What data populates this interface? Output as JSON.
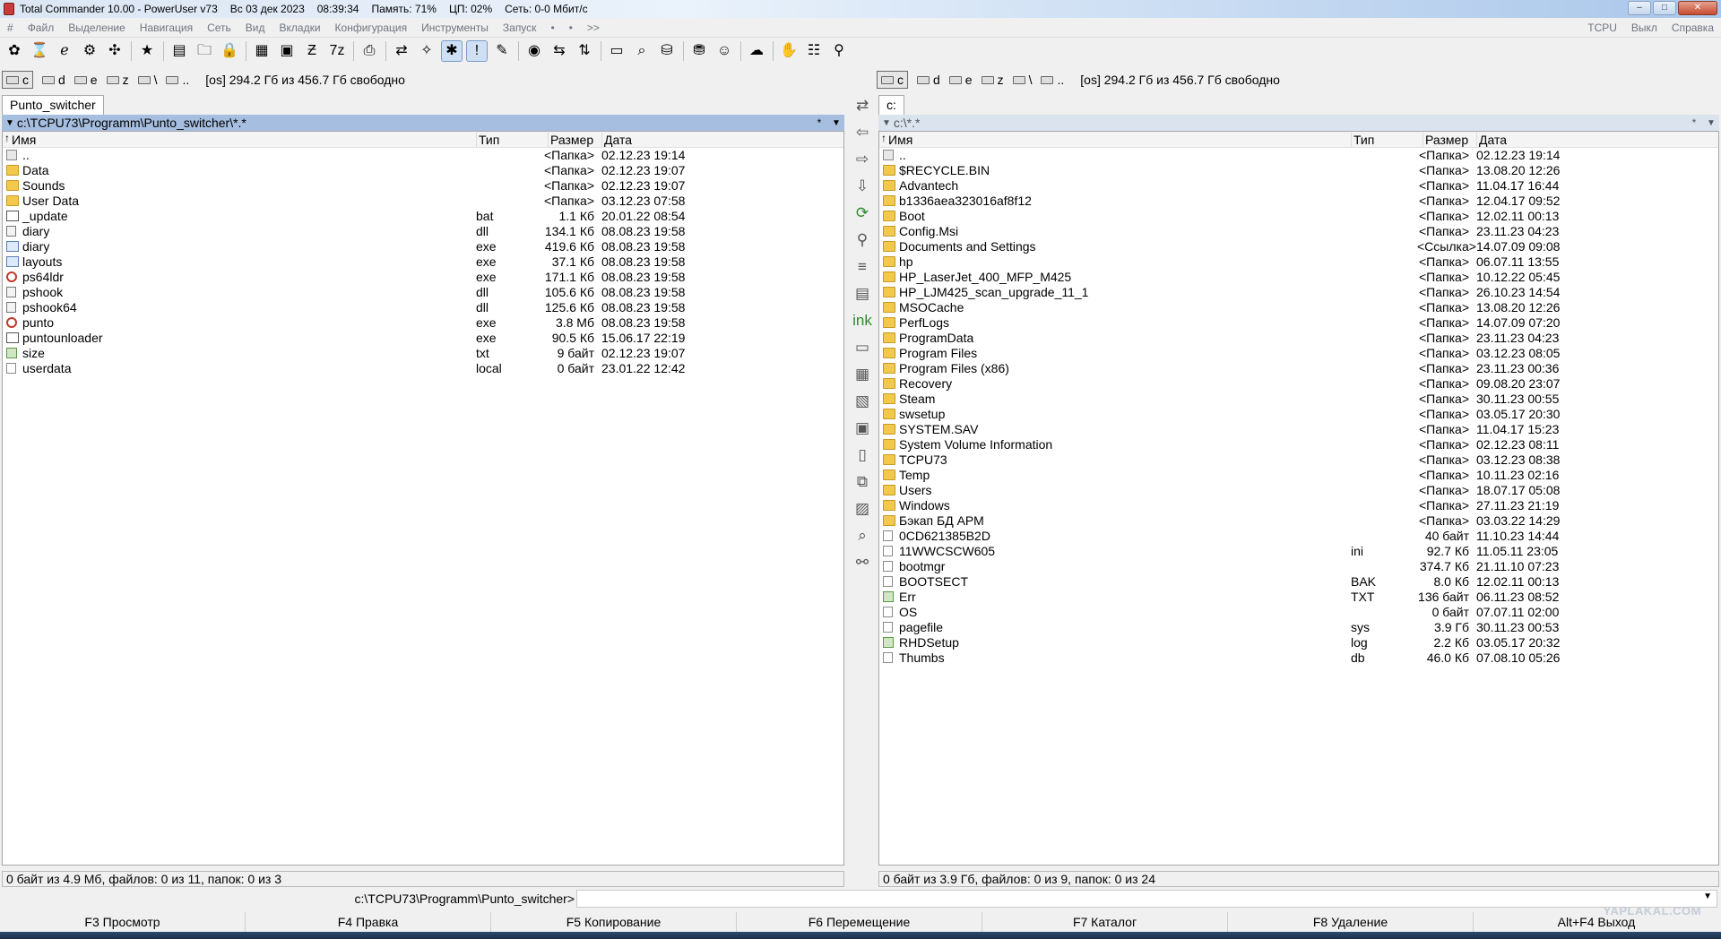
{
  "title_bar": {
    "app_title": "Total Commander 10.00 - PowerUser v73",
    "date": "Вс 03 дек 2023",
    "time": "08:39:34",
    "memory": "Память: 71%",
    "cpu": "ЦП: 02%",
    "network": "Сеть: 0-0 Мбит/с"
  },
  "menu": {
    "items": [
      "#",
      "Файл",
      "Выделение",
      "Навигация",
      "Сеть",
      "Вид",
      "Вкладки",
      "Конфигурация",
      "Инструменты",
      "Запуск",
      "•",
      "•",
      ">>"
    ],
    "right_items": [
      "TCPU",
      "Выкл",
      "Справка"
    ]
  },
  "toolbar": {
    "icons": [
      "paw-icon",
      "hourglass-icon",
      "ie-icon",
      "gear-icon",
      "puzzle-icon",
      "star-icon",
      "copy-names-icon",
      "folder-star-icon",
      "lock-icon",
      "winrar-icon",
      "archive-icon",
      "sfx-icon",
      "7z-icon",
      "printer-icon",
      "sync-icon",
      "wand-icon",
      "asterisk-icon",
      "alert-icon",
      "edit-icon",
      "ccleaner-icon",
      "compare-icon",
      "sort-icon",
      "folder-icon",
      "folder-search-icon",
      "drive-icon",
      "network-drive-icon",
      "rabbit-icon",
      "cloud-icon",
      "hand-icon",
      "tree-icon",
      "ftp-icon"
    ]
  },
  "left": {
    "drives": [
      "c",
      "d",
      "e",
      "z",
      "\\",
      ".."
    ],
    "active_drive": "c",
    "free_space": "[os]  294.2 Гб из 456.7 Гб свободно",
    "tab": "Punto_switcher",
    "path": "c:\\TCPU73\\Programm\\Punto_switcher\\*.*",
    "columns": [
      "Имя",
      "Тип",
      "Размер",
      "Дата"
    ],
    "files": [
      {
        "icon": "up",
        "name": "..",
        "type": "",
        "size": "<Папка>",
        "date": "02.12.23 19:14"
      },
      {
        "icon": "folder",
        "name": "Data",
        "type": "",
        "size": "<Папка>",
        "date": "02.12.23 19:07"
      },
      {
        "icon": "folder",
        "name": "Sounds",
        "type": "",
        "size": "<Папка>",
        "date": "02.12.23 19:07"
      },
      {
        "icon": "folder",
        "name": "User Data",
        "type": "",
        "size": "<Папка>",
        "date": "03.12.23 07:58"
      },
      {
        "icon": "bat",
        "name": "_update",
        "type": "bat",
        "size": "1.1 Кб",
        "date": "20.01.22 08:54"
      },
      {
        "icon": "dll",
        "name": "diary",
        "type": "dll",
        "size": "134.1 Кб",
        "date": "08.08.23 19:58"
      },
      {
        "icon": "exe",
        "name": "diary",
        "type": "exe",
        "size": "419.6 Кб",
        "date": "08.08.23 19:58"
      },
      {
        "icon": "exe",
        "name": "layouts",
        "type": "exe",
        "size": "37.1 Кб",
        "date": "08.08.23 19:58"
      },
      {
        "icon": "red",
        "name": "ps64ldr",
        "type": "exe",
        "size": "171.1 Кб",
        "date": "08.08.23 19:58"
      },
      {
        "icon": "dll",
        "name": "pshook",
        "type": "dll",
        "size": "105.6 Кб",
        "date": "08.08.23 19:58"
      },
      {
        "icon": "dll",
        "name": "pshook64",
        "type": "dll",
        "size": "125.6 Кб",
        "date": "08.08.23 19:58"
      },
      {
        "icon": "red",
        "name": "punto",
        "type": "exe",
        "size": "3.8 Мб",
        "date": "08.08.23 19:58"
      },
      {
        "icon": "bat",
        "name": "puntounloader",
        "type": "exe",
        "size": "90.5 Кб",
        "date": "15.06.17 22:19"
      },
      {
        "icon": "txt",
        "name": "size",
        "type": "txt",
        "size": "9 байт",
        "date": "02.12.23 19:07"
      },
      {
        "icon": "file",
        "name": "userdata",
        "type": "local",
        "size": "0 байт",
        "date": "23.01.22 12:42"
      }
    ],
    "status": "0 байт из 4.9 Мб, файлов: 0 из 11, папок: 0 из 3"
  },
  "right": {
    "drives": [
      "c",
      "d",
      "e",
      "z",
      "\\",
      ".."
    ],
    "active_drive": "c",
    "free_space": "[os]  294.2 Гб из 456.7 Гб свободно",
    "tab": "c:",
    "path": "c:\\*.*",
    "columns": [
      "Имя",
      "Тип",
      "Размер",
      "Дата"
    ],
    "files": [
      {
        "icon": "up",
        "name": "..",
        "type": "",
        "size": "<Папка>",
        "date": "02.12.23 19:14"
      },
      {
        "icon": "folder",
        "name": "$RECYCLE.BIN",
        "type": "",
        "size": "<Папка>",
        "date": "13.08.20 12:26"
      },
      {
        "icon": "folder",
        "name": "Advantech",
        "type": "",
        "size": "<Папка>",
        "date": "11.04.17 16:44"
      },
      {
        "icon": "folder",
        "name": "b1336aea323016af8f12",
        "type": "",
        "size": "<Папка>",
        "date": "12.04.17 09:52"
      },
      {
        "icon": "folder",
        "name": "Boot",
        "type": "",
        "size": "<Папка>",
        "date": "12.02.11 00:13"
      },
      {
        "icon": "folder",
        "name": "Config.Msi",
        "type": "",
        "size": "<Папка>",
        "date": "23.11.23 04:23"
      },
      {
        "icon": "folder",
        "name": "Documents and Settings",
        "type": "",
        "size": "<Ссылка>",
        "date": "14.07.09 09:08"
      },
      {
        "icon": "folder",
        "name": "hp",
        "type": "",
        "size": "<Папка>",
        "date": "06.07.11 13:55"
      },
      {
        "icon": "folder",
        "name": "HP_LaserJet_400_MFP_M425",
        "type": "",
        "size": "<Папка>",
        "date": "10.12.22 05:45"
      },
      {
        "icon": "folder",
        "name": "HP_LJM425_scan_upgrade_11_1",
        "type": "",
        "size": "<Папка>",
        "date": "26.10.23 14:54"
      },
      {
        "icon": "folder",
        "name": "MSOCache",
        "type": "",
        "size": "<Папка>",
        "date": "13.08.20 12:26"
      },
      {
        "icon": "folder",
        "name": "PerfLogs",
        "type": "",
        "size": "<Папка>",
        "date": "14.07.09 07:20"
      },
      {
        "icon": "folder",
        "name": "ProgramData",
        "type": "",
        "size": "<Папка>",
        "date": "23.11.23 04:23"
      },
      {
        "icon": "folder",
        "name": "Program Files",
        "type": "",
        "size": "<Папка>",
        "date": "03.12.23 08:05"
      },
      {
        "icon": "folder",
        "name": "Program Files (x86)",
        "type": "",
        "size": "<Папка>",
        "date": "23.11.23 00:36"
      },
      {
        "icon": "folder",
        "name": "Recovery",
        "type": "",
        "size": "<Папка>",
        "date": "09.08.20 23:07"
      },
      {
        "icon": "folder",
        "name": "Steam",
        "type": "",
        "size": "<Папка>",
        "date": "30.11.23 00:55"
      },
      {
        "icon": "folder",
        "name": "swsetup",
        "type": "",
        "size": "<Папка>",
        "date": "03.05.17 20:30"
      },
      {
        "icon": "folder",
        "name": "SYSTEM.SAV",
        "type": "",
        "size": "<Папка>",
        "date": "11.04.17 15:23"
      },
      {
        "icon": "folder",
        "name": "System Volume Information",
        "type": "",
        "size": "<Папка>",
        "date": "02.12.23 08:11"
      },
      {
        "icon": "folder",
        "name": "TCPU73",
        "type": "",
        "size": "<Папка>",
        "date": "03.12.23 08:38"
      },
      {
        "icon": "folder",
        "name": "Temp",
        "type": "",
        "size": "<Папка>",
        "date": "10.11.23 02:16"
      },
      {
        "icon": "folder",
        "name": "Users",
        "type": "",
        "size": "<Папка>",
        "date": "18.07.17 05:08"
      },
      {
        "icon": "folder",
        "name": "Windows",
        "type": "",
        "size": "<Папка>",
        "date": "27.11.23 21:19"
      },
      {
        "icon": "folder",
        "name": "Бэкап БД АРМ",
        "type": "",
        "size": "<Папка>",
        "date": "03.03.22 14:29"
      },
      {
        "icon": "file",
        "name": "0CD621385B2D",
        "type": "",
        "size": "40 байт",
        "date": "11.10.23 14:44"
      },
      {
        "icon": "file",
        "name": "11WWCSCW605",
        "type": "ini",
        "size": "92.7 Кб",
        "date": "11.05.11 23:05"
      },
      {
        "icon": "file",
        "name": "bootmgr",
        "type": "",
        "size": "374.7 Кб",
        "date": "21.11.10 07:23"
      },
      {
        "icon": "file",
        "name": "BOOTSECT",
        "type": "BAK",
        "size": "8.0 Кб",
        "date": "12.02.11 00:13"
      },
      {
        "icon": "txt",
        "name": "Err",
        "type": "TXT",
        "size": "136 байт",
        "date": "06.11.23 08:52"
      },
      {
        "icon": "file",
        "name": "OS",
        "type": "",
        "size": "0 байт",
        "date": "07.07.11 02:00"
      },
      {
        "icon": "file",
        "name": "pagefile",
        "type": "sys",
        "size": "3.9 Гб",
        "date": "30.11.23 00:53"
      },
      {
        "icon": "txt",
        "name": "RHDSetup",
        "type": "log",
        "size": "2.2 Кб",
        "date": "03.05.17 20:32"
      },
      {
        "icon": "file",
        "name": "Thumbs",
        "type": "db",
        "size": "46.0 Кб",
        "date": "07.08.10 05:26"
      }
    ],
    "status": "0 байт из 3.9 Гб, файлов: 0 из 9, папок: 0 из 24"
  },
  "middle_buttons": [
    "copy-to-right-icon",
    "arrow-left-icon",
    "arrow-right-icon",
    "arrow-down-icon",
    "refresh-icon",
    "pin-icon",
    "menu-icon",
    "edit-list-icon",
    "link-icon",
    "new-file-icon",
    "pack-icon",
    "unpack-icon",
    "test-archive-icon",
    "clipboard-icon",
    "copy-clipboard-icon",
    "paste-icon",
    "search-icon",
    "binoculars-icon"
  ],
  "command": {
    "prompt": "c:\\TCPU73\\Programm\\Punto_switcher>",
    "value": ""
  },
  "fkeys": [
    "F3 Просмотр",
    "F4 Правка",
    "F5 Копирование",
    "F6 Перемещение",
    "F7 Каталог",
    "F8 Удаление",
    "Alt+F4 Выход"
  ],
  "watermark": "YAPLAKAL.COM"
}
